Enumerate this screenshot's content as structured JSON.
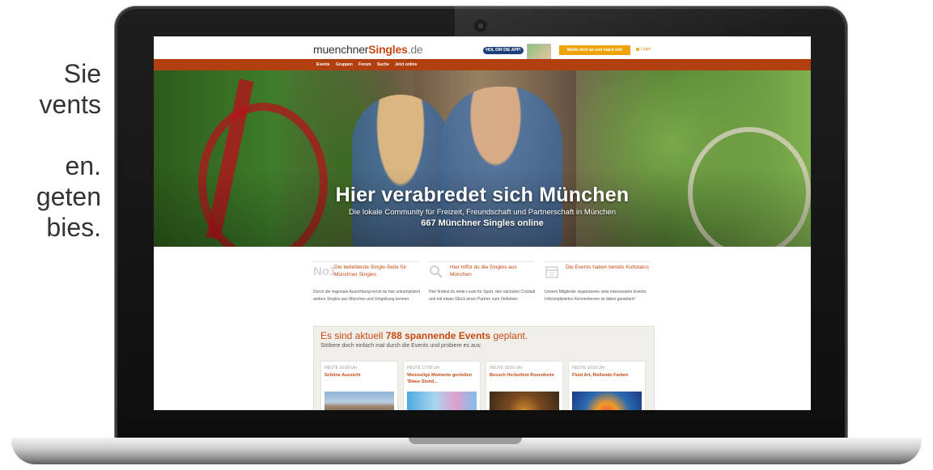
{
  "slide_text": {
    "line1": "Sie",
    "line2": "vents",
    "line3": "",
    "line4": "en.",
    "line5": "geten",
    "line6": "bies."
  },
  "site": {
    "logo": {
      "part1": "muenchner",
      "part2": "Singles",
      "part3": ".de"
    },
    "app_badge": "HOL DIR DIE APP!",
    "register_button": "Melde dich an und mach mit!",
    "login_label": "Login",
    "nav": [
      "Events",
      "Gruppen",
      "Forum",
      "Suche",
      "Jetzt online"
    ]
  },
  "hero": {
    "title": "Hier verabredet sich München",
    "subtitle": "Die lokale Community für Freizeit, Freundschaft und Partnerschaft in München",
    "online_count": "667 Münchner Singles online"
  },
  "features": [
    {
      "icon": "No1",
      "title": "Die beliebteste Single-Seite für Münchner Singles",
      "text": "Durch die regionale Ausrichtung lernst du hier unkompliziert andere Singles aus München und Umgebung kennen."
    },
    {
      "icon": "search-icon",
      "title": "Hier triffst du die Singles aus München",
      "text": "Hier findest du nette Leute für Sport, den nächsten Cocktail und mit etwas Glück einen Partner zum Verlieben."
    },
    {
      "icon": "calendar-icon",
      "title": "Die Events haben bereits Kultstatus",
      "text": "Unsere Mitglieder organisieren viele interessante Events. Unkompliziertes Kennenlernen ist dabei garantiert!"
    }
  ],
  "events": {
    "headline_pre": "Es sind aktuell",
    "headline_count": "788 spannende Events",
    "headline_post": "geplant.",
    "subline": "Stöbere doch einfach mal durch die Events und probiere es aus:",
    "cards": [
      {
        "time": "HEUTE 16:00 Uhr",
        "title": "Schöne Aussicht",
        "image": "munich-skyline"
      },
      {
        "time": "HEUTE 17:00 Uhr",
        "title": "Weinselige Momente genießen 'Blaue Stund...",
        "image": "party-people"
      },
      {
        "time": "HEUTE 18:00 Uhr",
        "title": "Besuch Herbstfest Rosenheim",
        "image": "ferris-wheel"
      },
      {
        "time": "HEUTE 18:00 Uhr",
        "title": "Fluid Art, fließende Farben",
        "image": "fluid-art"
      }
    ]
  },
  "colors": {
    "brand": "#c84a12",
    "nav_bg": "#b23f0f",
    "button": "#f0a40c",
    "app_badge": "#1d3f7a"
  }
}
